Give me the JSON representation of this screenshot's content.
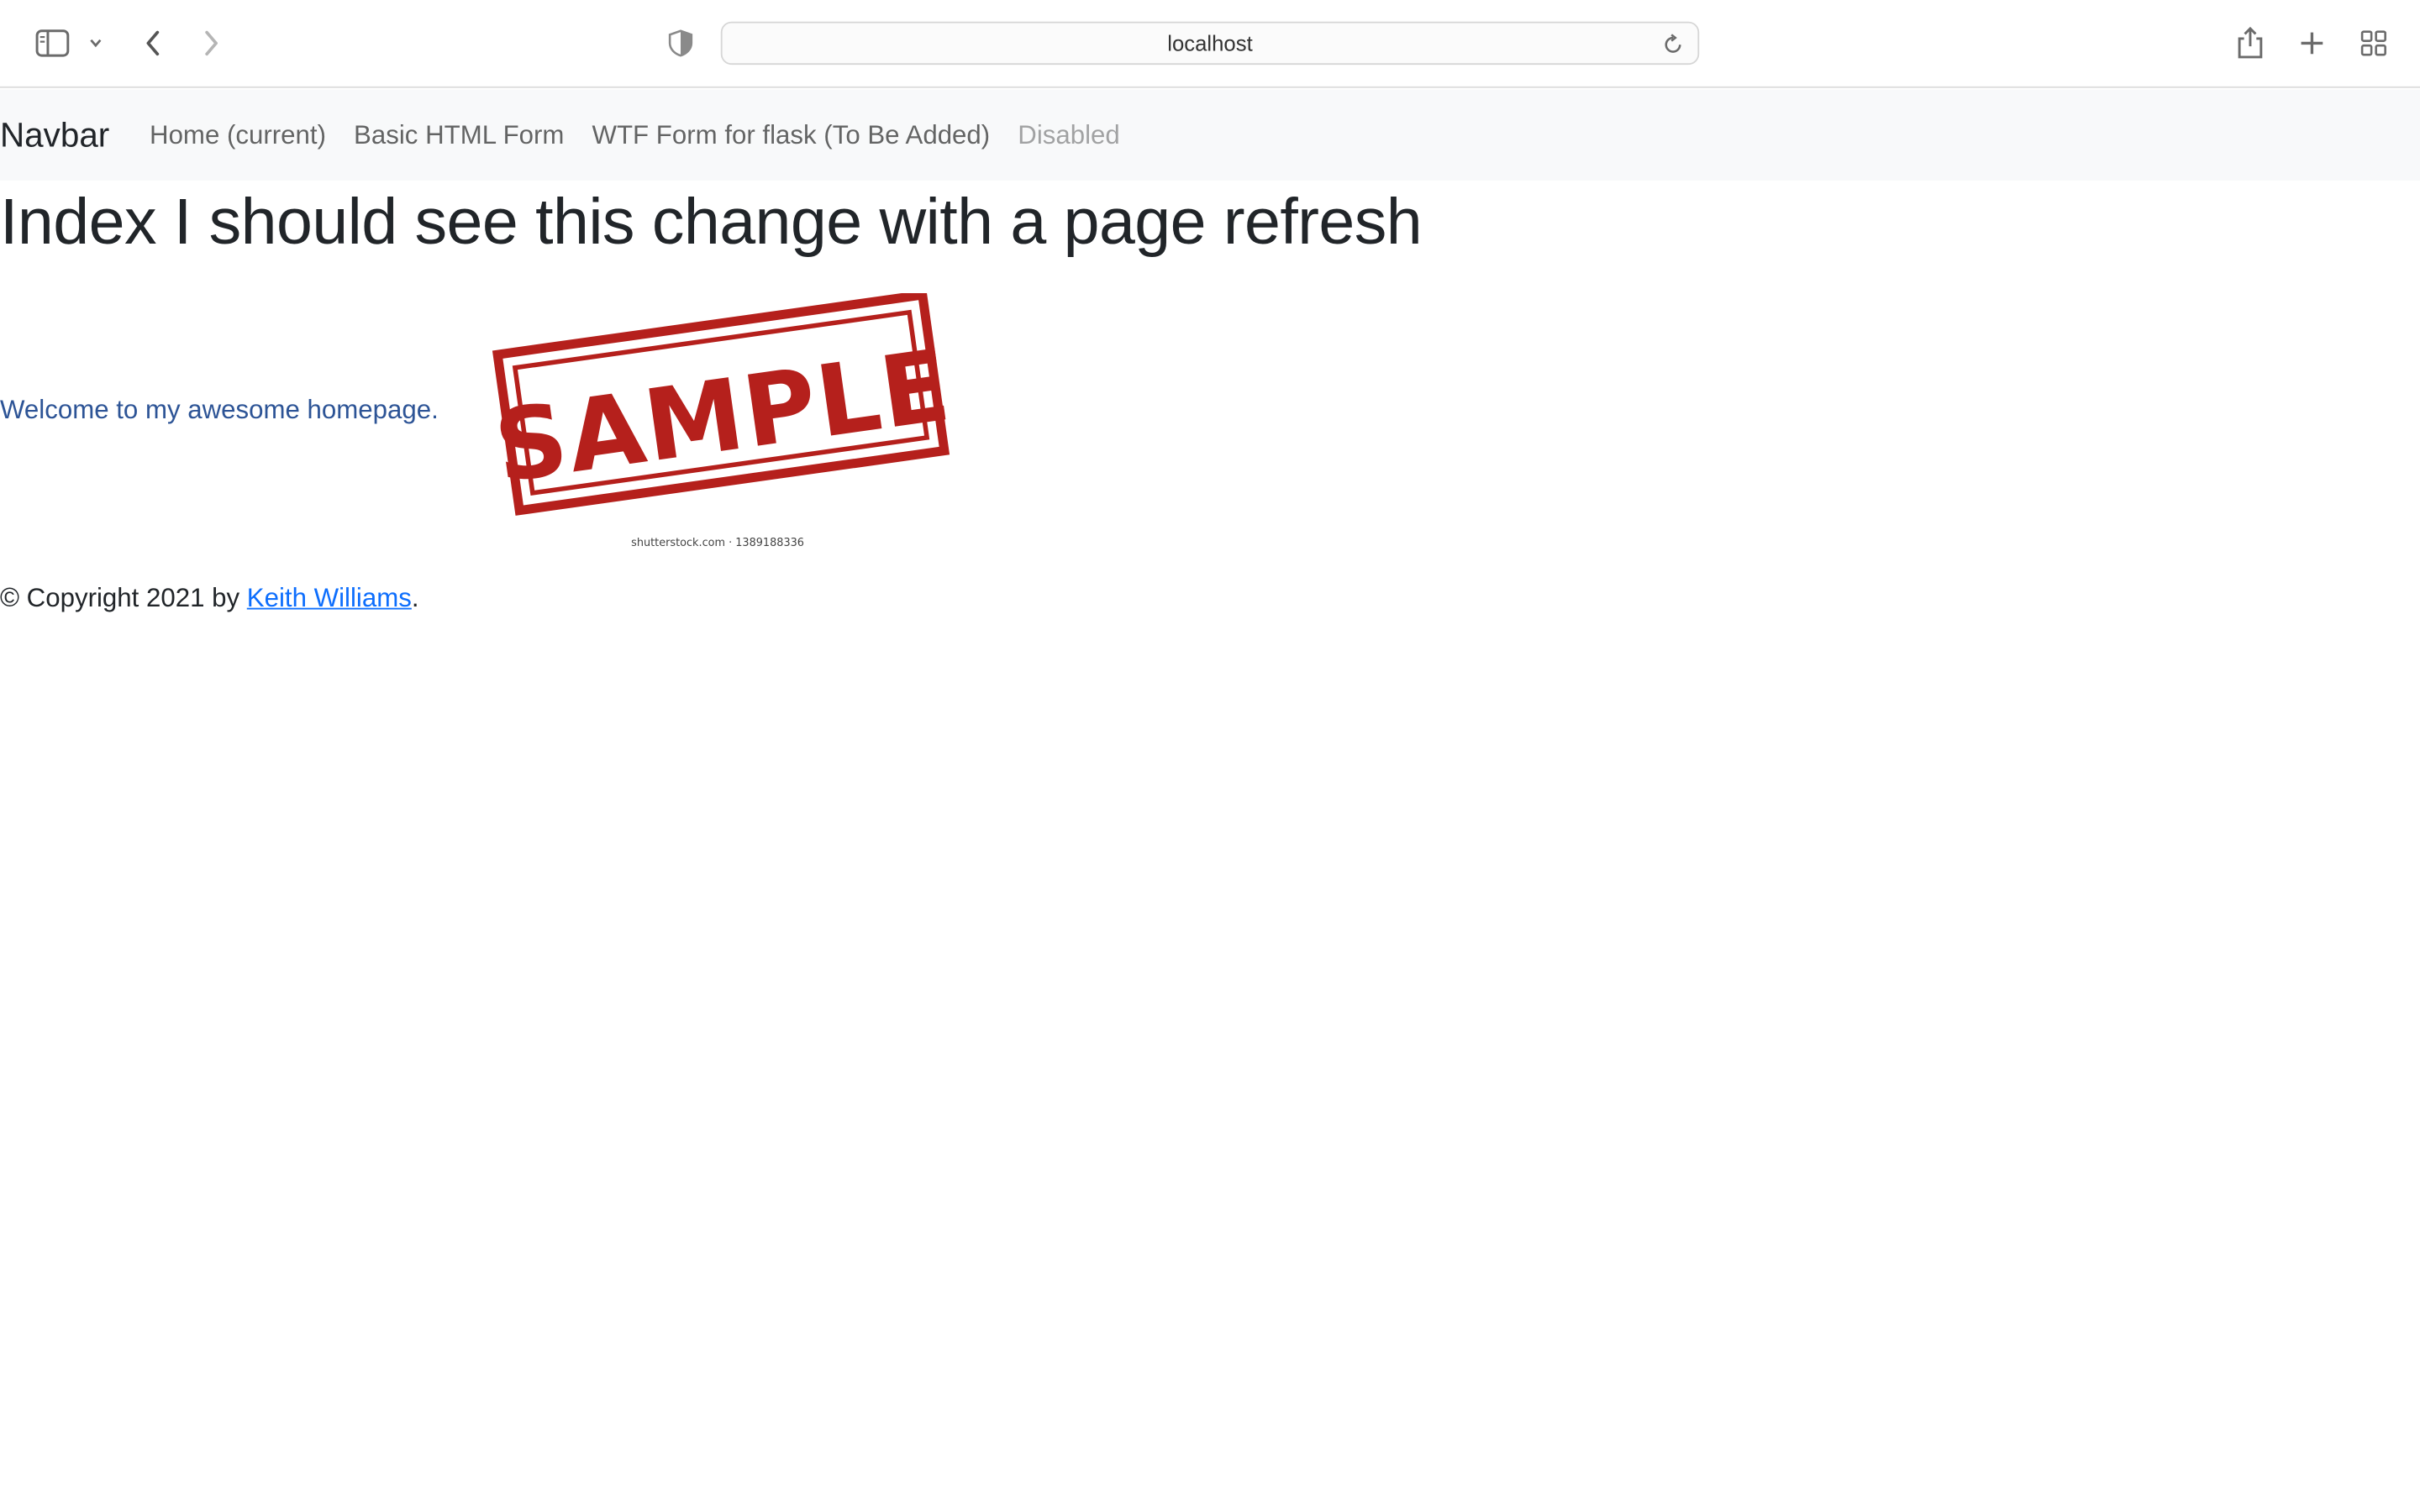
{
  "browser": {
    "address": "localhost",
    "icons": [
      "sidebar-icon",
      "chevron-down-icon",
      "back-arrow-icon",
      "forward-arrow-icon",
      "shield-icon",
      "reload-icon",
      "share-icon",
      "plus-icon",
      "tab-overview-icon"
    ]
  },
  "navbar": {
    "brand": "Navbar",
    "links": [
      {
        "label": "Home (current)",
        "disabled": false
      },
      {
        "label": "Basic HTML Form",
        "disabled": false
      },
      {
        "label": "WTF Form for flask (To Be Added)",
        "disabled": false
      },
      {
        "label": "Disabled",
        "disabled": true
      }
    ]
  },
  "main": {
    "title": "Index I should see this change with a page refresh",
    "welcome": "Welcome to my awesome homepage.",
    "image": {
      "stamp_text": "SAMPLE",
      "caption": "shutterstock.com · 1389188336",
      "stamp_color": "#b5201c"
    }
  },
  "footer": {
    "prefix": "© Copyright 2021 by ",
    "author": "Keith Williams",
    "suffix": "."
  },
  "colors": {
    "navbar_bg": "#f8f9fa",
    "link": "#0d6efd",
    "welcome_text": "#2d5496"
  }
}
